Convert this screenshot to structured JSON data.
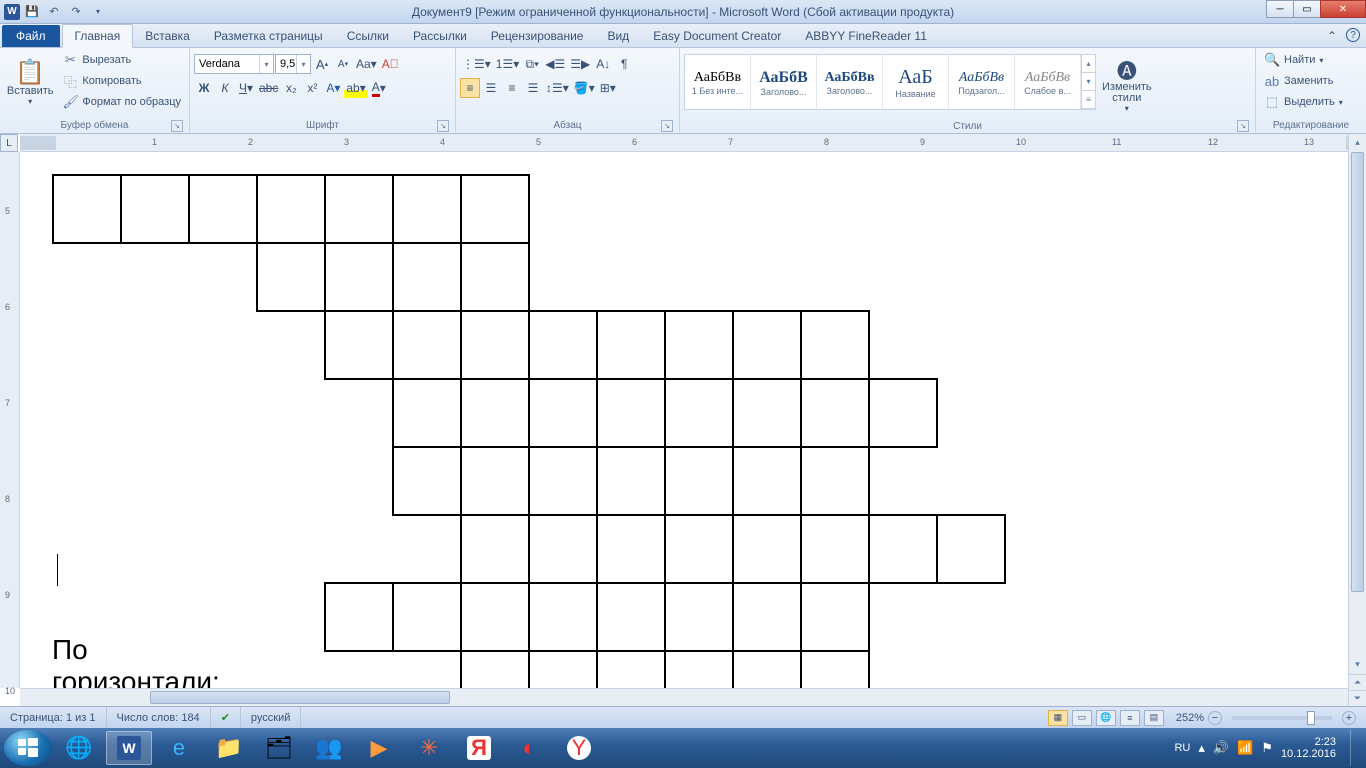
{
  "title": "Документ9 [Режим ограниченной функциональности]  -  Microsoft Word (Сбой активации продукта)",
  "tabs": {
    "file": "Файл",
    "items": [
      "Главная",
      "Вставка",
      "Разметка страницы",
      "Ссылки",
      "Рассылки",
      "Рецензирование",
      "Вид",
      "Easy Document Creator",
      "ABBYY FineReader 11"
    ]
  },
  "ribbon": {
    "clipboard": {
      "paste": "Вставить",
      "cut": "Вырезать",
      "copy": "Копировать",
      "format_painter": "Формат по образцу",
      "label": "Буфер обмена"
    },
    "font": {
      "name": "Verdana",
      "size": "9,5",
      "label": "Шрифт"
    },
    "paragraph": {
      "label": "Абзац"
    },
    "styles": {
      "label": "Стили",
      "items": [
        {
          "prev": "АаБбВв",
          "name": "1 Без инте...",
          "cls": ""
        },
        {
          "prev": "АаБбВ",
          "name": "Заголово...",
          "cls": "blue"
        },
        {
          "prev": "АаБбВв",
          "name": "Заголово...",
          "cls": "blue"
        },
        {
          "prev": "АаБ",
          "name": "Название",
          "cls": "blue big"
        },
        {
          "prev": "АаБбВв",
          "name": "Подзагол...",
          "cls": "blue"
        },
        {
          "prev": "АаБбВв",
          "name": "Слабое в...",
          "cls": ""
        }
      ],
      "change": "Изменить\nстили"
    },
    "editing": {
      "find": "Найти",
      "replace": "Заменить",
      "select": "Выделить",
      "label": "Редактирование"
    }
  },
  "ruler": {
    "max": 14
  },
  "doc": {
    "heading": "По горизонтали:",
    "crossword_rows": [
      {
        "col": 0,
        "len": 7
      },
      {
        "col": 3,
        "len": 4
      },
      {
        "col": 4,
        "len": 8
      },
      {
        "col": 5,
        "len": 8
      },
      {
        "col": 5,
        "len": 7
      },
      {
        "col": 6,
        "len": 8
      },
      {
        "col": 4,
        "len": 8
      },
      {
        "col": 6,
        "len": 6
      }
    ]
  },
  "status": {
    "page": "Страница: 1 из 1",
    "words": "Число слов: 184",
    "lang": "русский",
    "zoom": "252%"
  },
  "tray": {
    "lang": "RU",
    "time": "2:23",
    "date": "10.12.2016"
  }
}
